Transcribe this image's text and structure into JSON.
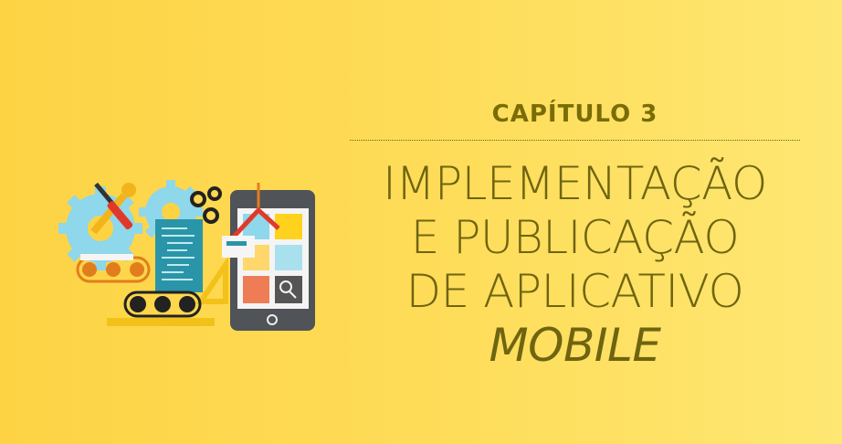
{
  "chapter_label": "CAPÍTULO 3",
  "title_lines": [
    "IMPLEMENTAÇÃO",
    "E PUBLICAÇÃO",
    "DE APLICATIVO"
  ],
  "title_italic": "MOBILE",
  "colors": {
    "background_start": "#fdd344",
    "background_end": "#fee773",
    "text": "#6f6410"
  },
  "illustration": {
    "icons": [
      "gear-icon",
      "wrench-icon",
      "screwdriver-icon",
      "code-document-icon",
      "smartphone-icon",
      "conveyor-belt-icon",
      "ruler-icon",
      "magnifier-icon",
      "robotic-arm-icon"
    ]
  }
}
